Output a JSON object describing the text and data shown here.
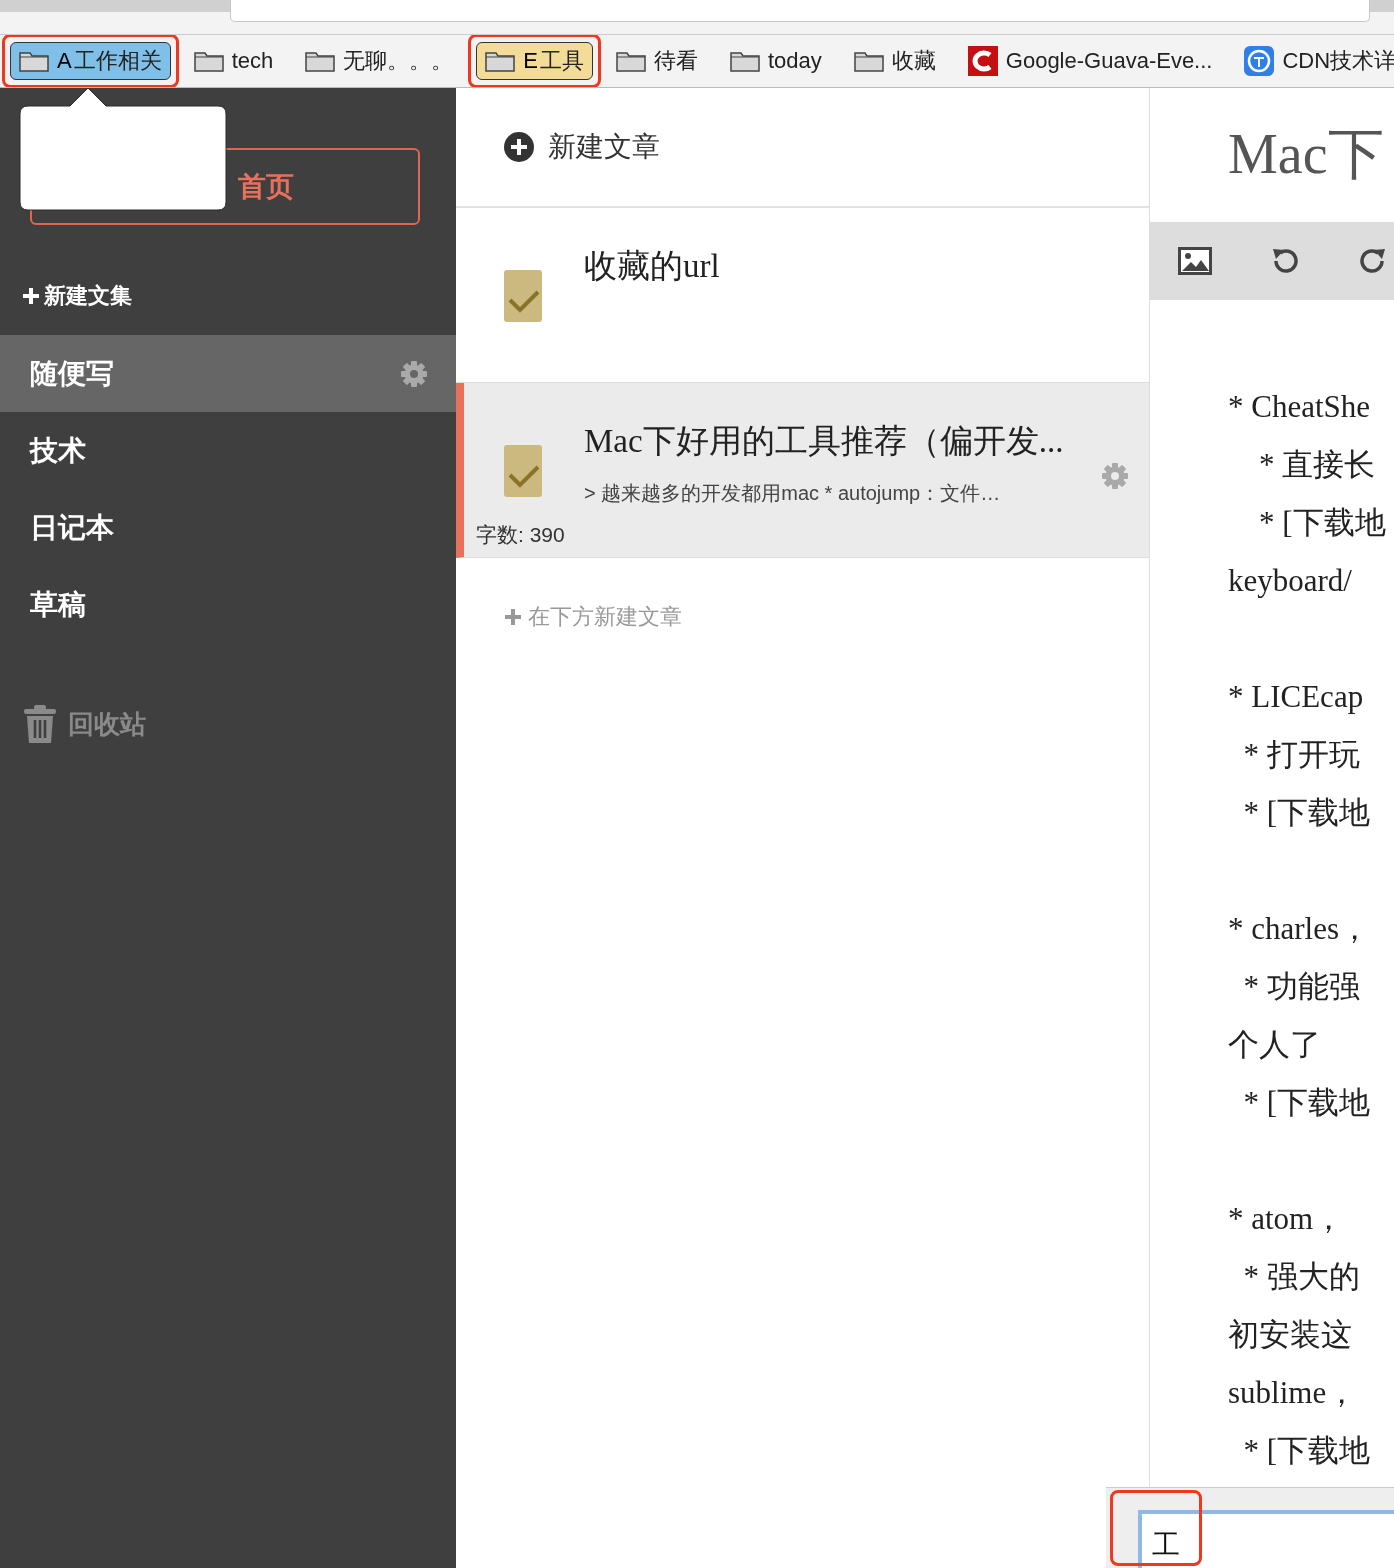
{
  "browser": {
    "bookmarks": [
      {
        "label": "工作相关",
        "kind": "folder",
        "color": "#7fbfe8",
        "overlay": "A",
        "annotated": true
      },
      {
        "label": "tech",
        "kind": "folder"
      },
      {
        "label": "无聊。。。",
        "kind": "folder"
      },
      {
        "label": "工具",
        "kind": "folder",
        "color": "#f2dc97",
        "overlay": "E",
        "annotated": true
      },
      {
        "label": "待看",
        "kind": "folder"
      },
      {
        "label": "today",
        "kind": "folder"
      },
      {
        "label": "收藏",
        "kind": "folder"
      },
      {
        "label": "Google-Guava-Eve...",
        "kind": "redlogo"
      },
      {
        "label": "CDN技术详",
        "kind": "bluelogo"
      }
    ]
  },
  "sidebar": {
    "home_button": "首页",
    "new_notebook": "新建文集",
    "notebooks": [
      {
        "name": "随便写",
        "selected": true
      },
      {
        "name": "技术",
        "selected": false
      },
      {
        "name": "日记本",
        "selected": false
      },
      {
        "name": "草稿",
        "selected": false
      }
    ],
    "trash": "回收站"
  },
  "notes": {
    "new_note": "新建文章",
    "items": [
      {
        "title": "收藏的url",
        "selected": false
      },
      {
        "title": "Mac下好用的工具推荐（偏开发...",
        "excerpt": "> 越来越多的开发都用mac * autojump：文件…",
        "word_count": "字数: 390",
        "selected": true
      }
    ],
    "add_below": "在下方新建文章"
  },
  "editor": {
    "title": "Mac下",
    "paragraphs": [
      [
        "* CheatShe",
        "    * 直接长",
        "    * [下载地",
        "keyboard/"
      ],
      [
        "* LICEcap",
        "  * 打开玩",
        "  * [下载地"
      ],
      [
        "* charles，",
        "  * 功能强",
        "个人了",
        "  * [下载地"
      ],
      [
        "* atom，",
        "  * 强大的",
        "初安装这",
        "sublime，",
        "  * [下载地"
      ]
    ]
  },
  "ime": {
    "value": "工",
    "annotated": true
  }
}
